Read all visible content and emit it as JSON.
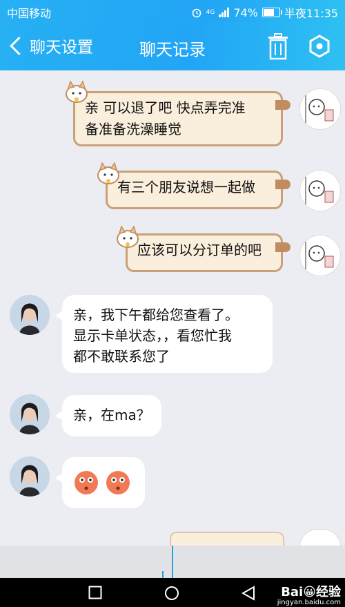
{
  "status": {
    "carrier": "中国移动",
    "network": "4G",
    "battery": "74%",
    "battery_level": 0.74,
    "time": "半夜11:35"
  },
  "header": {
    "back_label": "聊天设置",
    "title": "聊天记录"
  },
  "messages": [
    {
      "from": "me",
      "text_lines": [
        "亲 可以退了吧 快点弄完准",
        "备准备洗澡睡觉"
      ]
    },
    {
      "from": "me",
      "text_lines": [
        "有三个朋友说想一起做"
      ]
    },
    {
      "from": "me",
      "text_lines": [
        "应该可以分订单的吧"
      ]
    },
    {
      "from": "other",
      "text_lines": [
        "亲，我下午都给您查看了。",
        "显示卡单状态，，看您忙我",
        "都不敢联系您了"
      ]
    },
    {
      "from": "other",
      "text_lines": [
        "亲，在ma？"
      ]
    },
    {
      "from": "other",
      "emojis": [
        "blush-face-icon",
        "blush-face-icon"
      ]
    }
  ],
  "watermark": {
    "brand": "Bai😀经验",
    "url": "jingyan.baidu.com"
  }
}
